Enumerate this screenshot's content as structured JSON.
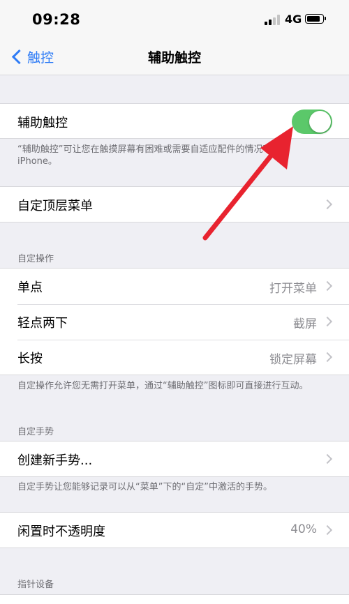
{
  "status_bar": {
    "time": "09:28",
    "network": "4G",
    "signal_icon": "signal-bars-icon",
    "battery_icon": "battery-icon"
  },
  "nav": {
    "back_label": "触控",
    "back_icon": "chevron-left-icon",
    "title": "辅助触控"
  },
  "assistive": {
    "label": "辅助触控",
    "toggle_on": true,
    "toggle_color": "#5bc86a",
    "footer": "“辅助触控”可让您在触摸屏幕有困难或需要自适应配件的情况下使用iPhone。"
  },
  "customize_menu": {
    "label": "自定顶层菜单"
  },
  "custom_actions": {
    "header": "自定操作",
    "items": [
      {
        "label": "单点",
        "value": "打开菜单"
      },
      {
        "label": "轻点两下",
        "value": "截屏"
      },
      {
        "label": "长按",
        "value": "锁定屏幕"
      }
    ],
    "footer": "自定操作允许您无需打开菜单，通过“辅助触控”图标即可直接进行互动。"
  },
  "custom_gestures": {
    "header": "自定手势",
    "create_label": "创建新手势...",
    "footer": "自定手势让您能够记录可以从“菜单”下的“自定”中激活的手势。"
  },
  "idle_opacity": {
    "label": "闲置时不透明度",
    "value": "40%"
  },
  "pointer_devices": {
    "header": "指针设备"
  },
  "annotation": {
    "icon": "red-arrow-annotation-icon",
    "color": "#e8232f"
  }
}
